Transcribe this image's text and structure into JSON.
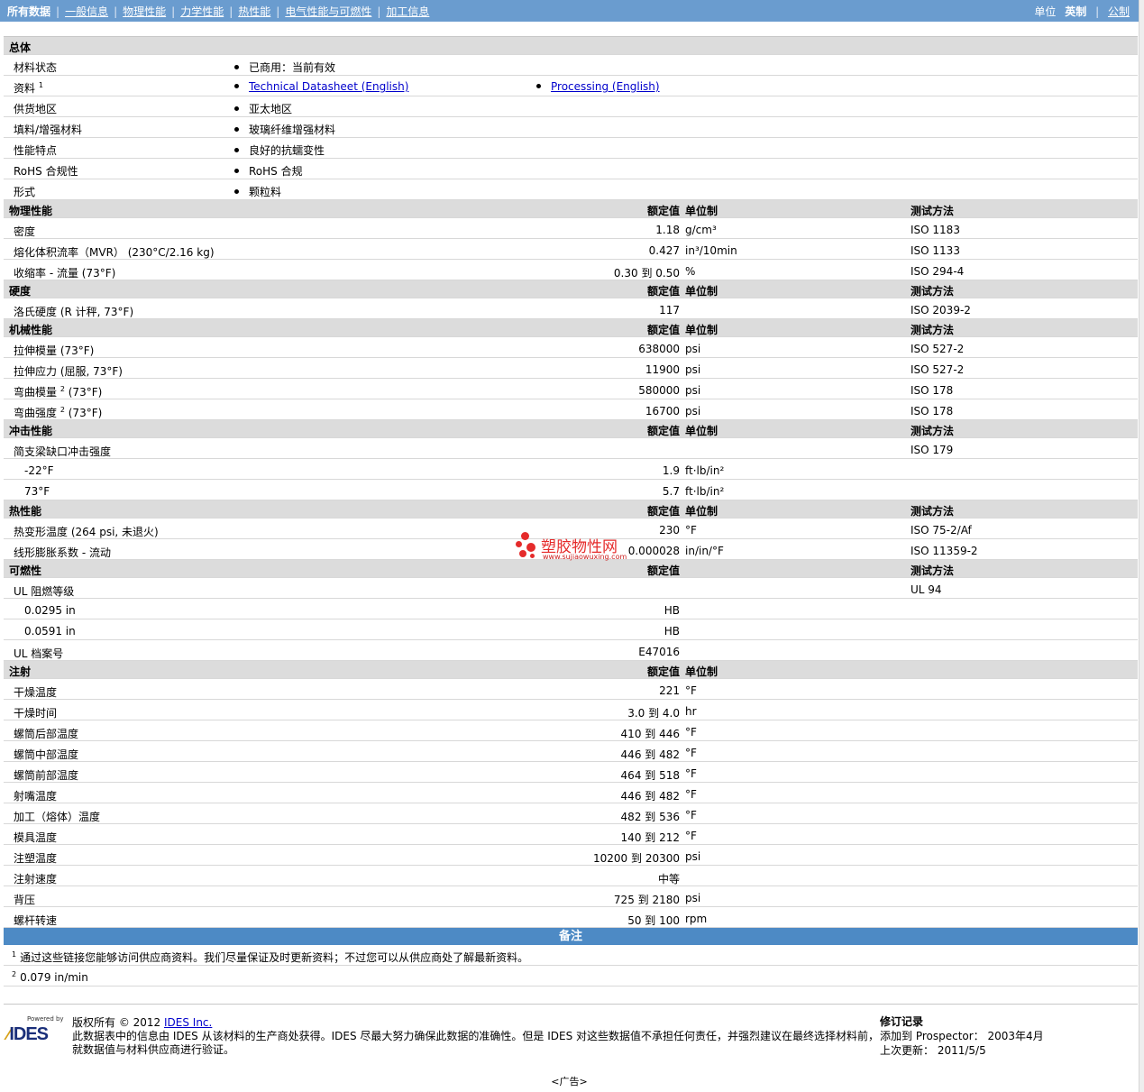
{
  "nav": {
    "tabs": [
      "所有数据",
      "一般信息",
      "物理性能",
      "力学性能",
      "热性能",
      "电气性能与可燃性",
      "加工信息"
    ],
    "units_label": "单位",
    "unit_english": "英制",
    "unit_metric": "公制"
  },
  "sheet": {
    "general": {
      "title": "总体",
      "rows": [
        {
          "label": "材料状态",
          "sup": "",
          "v1": "已商用：当前有效",
          "v2": ""
        },
        {
          "label": "资料",
          "sup": "1",
          "v1": "Technical Datasheet (English)",
          "v2": "Processing (English)",
          "links": true
        },
        {
          "label": "供货地区",
          "sup": "",
          "v1": "亚太地区",
          "v2": ""
        },
        {
          "label": "填料/增强材料",
          "sup": "",
          "v1": "玻璃纤维增强材料",
          "v2": ""
        },
        {
          "label": "性能特点",
          "sup": "",
          "v1": "良好的抗蠕变性",
          "v2": ""
        },
        {
          "label": "RoHS 合规性",
          "sup": "",
          "v1": "RoHS 合规",
          "v2": ""
        },
        {
          "label": "形式",
          "sup": "",
          "v1": "颗粒料",
          "v2": ""
        }
      ]
    },
    "col_rated": "额定值",
    "col_unit": "单位制",
    "col_test": "测试方法",
    "sections": [
      {
        "title": "物理性能",
        "show_unit": true,
        "show_test": true,
        "rows": [
          {
            "label": "密度",
            "val": "1.18",
            "unit": "g/cm³",
            "test": "ISO 1183"
          },
          {
            "label": "熔化体积流率（MVR） (230°C/2.16 kg)",
            "val": "0.427",
            "unit": "in³/10min",
            "test": "ISO 1133"
          },
          {
            "label": "收缩率 - 流量 (73°F)",
            "val": "0.30 到  0.50",
            "unit": "%",
            "test": "ISO 294-4"
          }
        ]
      },
      {
        "title": "硬度",
        "show_unit": true,
        "show_test": true,
        "rows": [
          {
            "label": "洛氏硬度 (R 计秤, 73°F)",
            "val": "117",
            "unit": "",
            "test": "ISO 2039-2"
          }
        ]
      },
      {
        "title": "机械性能",
        "show_unit": true,
        "show_test": true,
        "rows": [
          {
            "label": "拉伸模量 (73°F)",
            "val": "638000",
            "unit": "psi",
            "test": "ISO 527-2"
          },
          {
            "label": "拉伸应力 (屈服, 73°F)",
            "val": "11900",
            "unit": "psi",
            "test": "ISO 527-2"
          },
          {
            "label": "弯曲模量",
            "sup": "2",
            "suffix": " (73°F)",
            "val": "580000",
            "unit": "psi",
            "test": "ISO 178"
          },
          {
            "label": "弯曲强度",
            "sup": "2",
            "suffix": " (73°F)",
            "val": "16700",
            "unit": "psi",
            "test": "ISO 178"
          }
        ]
      },
      {
        "title": "冲击性能",
        "show_unit": true,
        "show_test": true,
        "rows": [
          {
            "label": "简支梁缺口冲击强度",
            "val": "",
            "unit": "",
            "test": "ISO 179"
          },
          {
            "label": "-22°F",
            "indent": true,
            "val": "1.9",
            "unit": "ft·lb/in²",
            "test": ""
          },
          {
            "label": "73°F",
            "indent": true,
            "val": "5.7",
            "unit": "ft·lb/in²",
            "test": ""
          }
        ]
      },
      {
        "title": "热性能",
        "show_unit": true,
        "show_test": true,
        "rows": [
          {
            "label": "热变形温度 (264 psi, 未退火)",
            "val": "230",
            "unit": "°F",
            "test": "ISO 75-2/Af"
          },
          {
            "label": "线形膨胀系数 - 流动",
            "val": "0.000028",
            "unit": "in/in/°F",
            "test": "ISO 11359-2"
          }
        ]
      },
      {
        "title": "可燃性",
        "show_unit": false,
        "show_test": true,
        "rows": [
          {
            "label": "UL 阻燃等级",
            "val": "",
            "unit": "",
            "test": "UL 94"
          },
          {
            "label": "0.0295 in",
            "indent": true,
            "val": "HB",
            "unit": "",
            "test": ""
          },
          {
            "label": "0.0591 in",
            "indent": true,
            "val": "HB",
            "unit": "",
            "test": ""
          },
          {
            "label": "UL 档案号",
            "val": "E47016",
            "unit": "",
            "test": ""
          }
        ]
      },
      {
        "title": "注射",
        "show_unit": true,
        "show_test": false,
        "rows": [
          {
            "label": "干燥温度",
            "val": "221",
            "unit": "°F",
            "test": ""
          },
          {
            "label": "干燥时间",
            "val": "3.0 到  4.0",
            "unit": "hr",
            "test": ""
          },
          {
            "label": "螺筒后部温度",
            "val": "410 到  446",
            "unit": "°F",
            "test": ""
          },
          {
            "label": "螺筒中部温度",
            "val": "446 到  482",
            "unit": "°F",
            "test": ""
          },
          {
            "label": "螺筒前部温度",
            "val": "464 到  518",
            "unit": "°F",
            "test": ""
          },
          {
            "label": "射嘴温度",
            "val": "446 到  482",
            "unit": "°F",
            "test": ""
          },
          {
            "label": "加工（熔体）温度",
            "val": "482 到  536",
            "unit": "°F",
            "test": ""
          },
          {
            "label": "模具温度",
            "val": "140 到  212",
            "unit": "°F",
            "test": ""
          },
          {
            "label": "注塑温度",
            "val": "10200 到  20300",
            "unit": "psi",
            "test": ""
          },
          {
            "label": "注射速度",
            "val": "中等",
            "unit": "",
            "test": ""
          },
          {
            "label": "背压",
            "val": "725 到  2180",
            "unit": "psi",
            "test": ""
          },
          {
            "label": "螺杆转速",
            "val": "50 到  100",
            "unit": "rpm",
            "test": ""
          }
        ]
      }
    ]
  },
  "notes": {
    "title": "备注",
    "items": [
      {
        "num": "1",
        "text": "通过这些链接您能够访问供应商资料。我们尽量保证及时更新资料；不过您可以从供应商处了解最新资料。"
      },
      {
        "num": "2",
        "text": "0.079 in/min"
      }
    ]
  },
  "footer": {
    "logo_powered": "Powered by",
    "logo_text": "IDES",
    "copyright_prefix": "版权所有 © 2012 ",
    "copyright_link": "IDES Inc.",
    "disclaimer_1": "此数据表中的信息由 IDES 从该材料的生产商处获得。IDES 尽最大努力确保此数据的准确性。但是 IDES 对这些数据值不承担任何责任，并强烈建议在最终选择材料前，",
    "disclaimer_2": "就数据值与材料供应商进行验证。",
    "rev_title": "修订记录",
    "rev_added": "添加到 Prospector： 2003年4月",
    "rev_updated": "上次更新： 2011/5/5",
    "ad": "<广告>"
  },
  "watermark": {
    "text": "塑胶物性网",
    "url": "www.sujiaowuxing.com"
  },
  "colors": {
    "nav_bg": "#6a9ccf",
    "section_bg": "#dcdcdc",
    "notes_bg": "#4d8ac5",
    "link": "#0000cc",
    "watermark": "#e52b2b"
  }
}
